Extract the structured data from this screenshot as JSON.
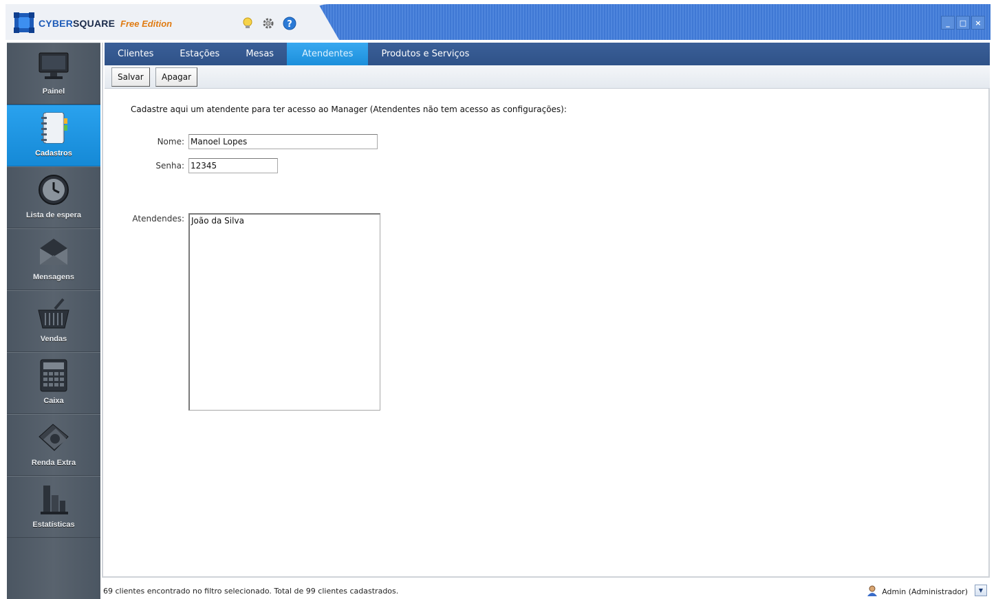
{
  "app": {
    "brand_part1": "CYBER",
    "brand_part2": "SQUARE",
    "edition": "Free Edition",
    "icons": [
      "lightbulb-icon",
      "gear-icon",
      "help-icon"
    ]
  },
  "window_controls": {
    "minimize": "_",
    "restore": "□",
    "close": "×"
  },
  "sidebar": {
    "items": [
      {
        "label": "Painel",
        "icon": "monitor-icon",
        "active": false
      },
      {
        "label": "Cadastros",
        "icon": "notebook-icon",
        "active": true
      },
      {
        "label": "Lista de espera",
        "icon": "clock-icon",
        "active": false
      },
      {
        "label": "Mensagens",
        "icon": "envelope-icon",
        "active": false
      },
      {
        "label": "Vendas",
        "icon": "basket-icon",
        "active": false
      },
      {
        "label": "Caixa",
        "icon": "calculator-icon",
        "active": false
      },
      {
        "label": "Renda Extra",
        "icon": "money-icon",
        "active": false
      },
      {
        "label": "Estatísticas",
        "icon": "bar-chart-icon",
        "active": false
      }
    ]
  },
  "tabs": [
    {
      "label": "Clientes",
      "active": false
    },
    {
      "label": "Estações",
      "active": false
    },
    {
      "label": "Mesas",
      "active": false
    },
    {
      "label": "Atendentes",
      "active": true
    },
    {
      "label": "Produtos e Serviços",
      "active": false
    }
  ],
  "toolbar": {
    "save_label": "Salvar",
    "delete_label": "Apagar"
  },
  "form": {
    "intro": "Cadastre aqui um atendente para ter acesso ao Manager (Atendentes não tem acesso as configurações):",
    "name_label": "Nome:",
    "name_value": "Manoel Lopes",
    "password_label": "Senha:",
    "password_value": "12345",
    "list_label": "Atendendes:",
    "list_items": [
      "João da Silva"
    ]
  },
  "status": {
    "text": "69 clientes encontrado no filtro selecionado. Total de 99 clientes cadastrados.",
    "user": "Admin (Administrador)"
  },
  "colors": {
    "tab_bar": "#2f5288",
    "active_tab": "#1c8fdb",
    "active_nav": "#1589d6",
    "sidebar": "#4b5662",
    "edition": "#e07b12"
  }
}
